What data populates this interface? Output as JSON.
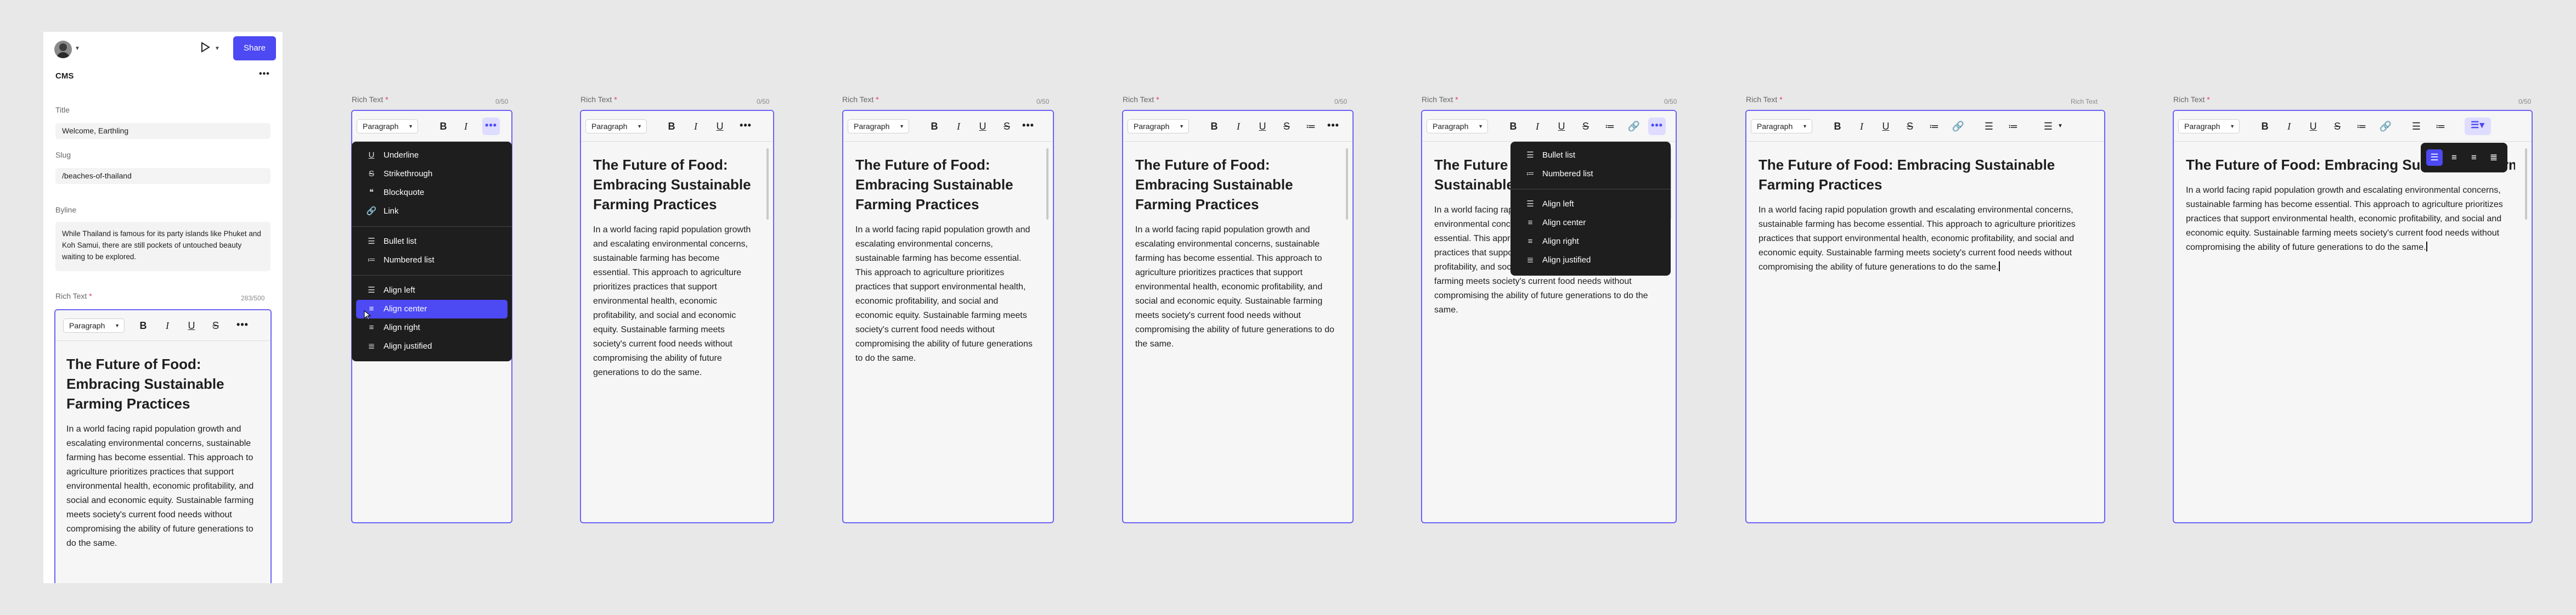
{
  "cms": {
    "share": "Share",
    "section": "CMS",
    "title_label": "Title",
    "title_value": "Welcome, Earthling",
    "slug_label": "Slug",
    "slug_value": "/beaches-of-thailand",
    "byline_label": "Byline",
    "byline_value": "While Thailand is famous for its party islands like Phuket and Koh Samui, there are still pockets of untouched beauty waiting to be explored.",
    "rich_text_label": "Rich Text",
    "required_mark": "*",
    "char_count": "283/500"
  },
  "editor": {
    "paragraph": "Paragraph",
    "bold": "B",
    "italic": "I",
    "underline": "U",
    "strike": "S",
    "more": "•••",
    "heading": "The Future of Food: Embracing Sustainable Farming Practices",
    "body": "In a world facing rapid population growth and escalating environmental concerns, sustainable farming has become essential. This approach to agriculture prioritizes practices that support environmental health, economic profitability, and social and economic equity. Sustainable farming meets society's current food needs without compromising the ability of future generations to do the same.",
    "count_a": "0/50",
    "count_b": "Rich Text"
  },
  "menu_full": {
    "items": [
      "Underline",
      "Strikethrough",
      "Blockquote",
      "Link",
      "Bullet list",
      "Numbered list",
      "Align left",
      "Align center",
      "Align right",
      "Align justified"
    ],
    "selected": "Align center"
  },
  "menu_small": {
    "items": [
      "Bullet list",
      "Numbered list",
      "Align left",
      "Align center",
      "Align right",
      "Align justified"
    ]
  },
  "colors": {
    "accent": "#4d49f3",
    "selection_bg": "#dedcff",
    "menu_bg": "#1e1e1e"
  }
}
